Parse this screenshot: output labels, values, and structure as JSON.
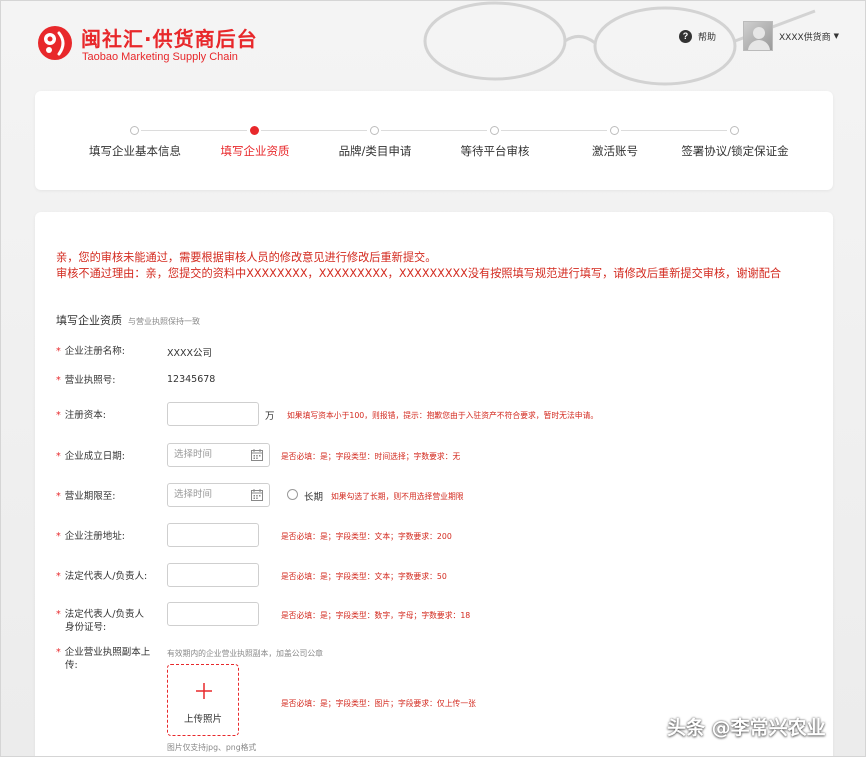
{
  "header": {
    "logo_title": "闽社汇·供货商后台",
    "logo_subtitle": "Taobao Marketing Supply Chain",
    "help_label": "帮助",
    "user_name": "XXXX供货商",
    "brand_color": "#e8282b"
  },
  "steps": [
    {
      "label": "填写企业基本信息",
      "active": false
    },
    {
      "label": "填写企业资质",
      "active": true
    },
    {
      "label": "品牌/类目申请",
      "active": false
    },
    {
      "label": "等待平台审核",
      "active": false
    },
    {
      "label": "激活账号",
      "active": false
    },
    {
      "label": "签署协议/锁定保证金",
      "active": false
    }
  ],
  "notice": {
    "line1": "亲，您的审核未能通过，需要根据审核人员的修改意见进行修改后重新提交。",
    "line2": "审核不通过理由：亲，您提交的资料中XXXXXXXX，XXXXXXXXX，XXXXXXXXX没有按照填写规范进行填写，请修改后重新提交审核，谢谢配合"
  },
  "section": {
    "title": "填写企业资质",
    "hint": "与营业执照保持一致"
  },
  "fields": {
    "reg_name": {
      "label": "企业注册名称:",
      "value": "XXXX公司"
    },
    "license_no": {
      "label": "营业执照号:",
      "value": "12345678"
    },
    "capital": {
      "label": "注册资本:",
      "unit": "万",
      "tip": "如果填写资本小于100，则报错，提示：抱歉您由于入驻资产不符合要求，暂时无法申请。"
    },
    "found_date": {
      "label": "企业成立日期:",
      "placeholder": "选择时间",
      "tip": "是否必填：是；字段类型：时间选择；字数要求：无"
    },
    "term": {
      "label": "营业期限至:",
      "placeholder": "选择时间",
      "radio_label": "长期",
      "tip": "如果勾选了长期，则不用选择营业期限"
    },
    "address": {
      "label": "企业注册地址:",
      "tip": "是否必填：是；字段类型：文本；字数要求：200"
    },
    "legal_rep": {
      "label": "法定代表人/负责人:",
      "tip": "是否必填：是；字段类型：文本；字数要求：50"
    },
    "legal_id": {
      "label_line1": "法定代表人/负责人",
      "label_line2": "身份证号:",
      "tip": "是否必填：是；字段类型：数字，字母；字数要求：18"
    },
    "license_copy": {
      "label_line1": "企业营业执照副本上",
      "label_line2": "传:",
      "hint": "有效期内的企业营业执照副本，加盖公司公章",
      "upload_label": "上传照片",
      "tip": "是否必填：是；字段类型：图片；字段要求：仅上传一张",
      "format": "图片仅支持jpg、png格式"
    }
  },
  "watermark": "头条 @李常兴农业"
}
